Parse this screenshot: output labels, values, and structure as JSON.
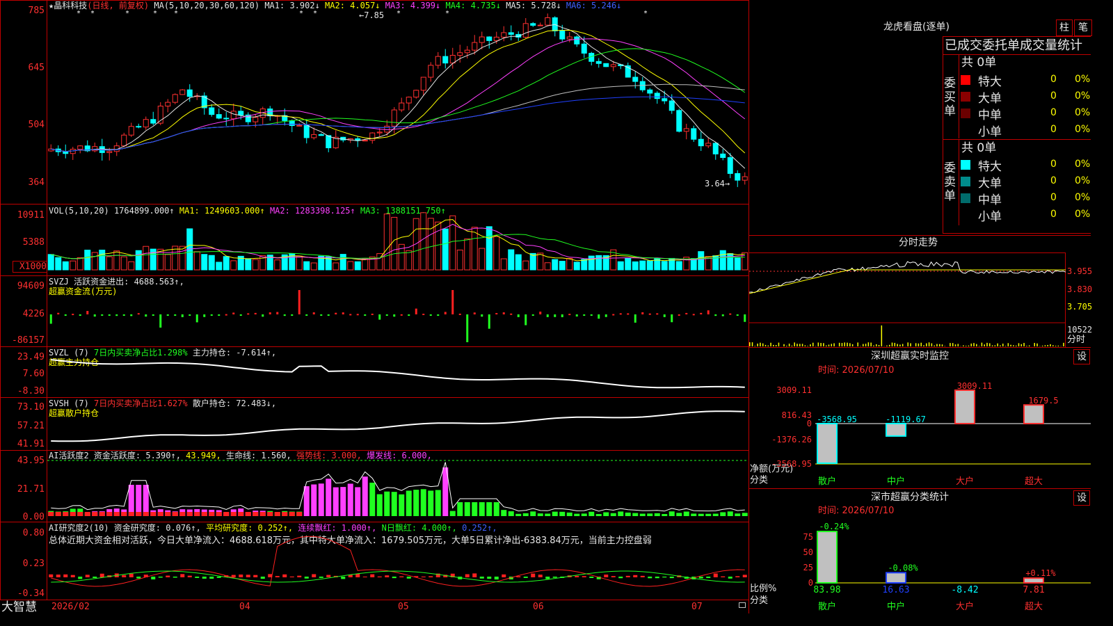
{
  "stock": {
    "title": "★晶科科技",
    "period": "(日线, 前复权)"
  },
  "ma_header": {
    "label": "MA(5,10,20,30,60,120)",
    "ma1": "MA1: 3.902↓",
    "ma2": "MA2: 4.057↓",
    "ma3": "MA3: 4.399↓",
    "ma4": "MA4: 4.735↓",
    "ma5": "MA5: 5.728↓",
    "ma6": "MA6: 5.246↓"
  },
  "price_axis": [
    "785",
    "645",
    "504",
    "364"
  ],
  "price_marks": {
    "high": "←7.85",
    "low": "3.64→"
  },
  "vol_header": {
    "label": "VOL(5,10,20)",
    "vol": "1764899.000↑",
    "ma1": "MA1: 1249603.000↑",
    "ma2": "MA2: 1283398.125↑",
    "ma3": "MA3: 1388151.750↑"
  },
  "vol_axis": [
    "10911",
    "5388",
    "X1000"
  ],
  "svzj": {
    "label": "SVZJ  活跃资金进出: 4688.563↑,",
    "sub": "超赢资金流(万元)",
    "axis": [
      "94609",
      "4226",
      "-86157"
    ]
  },
  "svzl": {
    "label": "SVZL (7)",
    "pct": "7日内买卖净占比1.298%",
    "hold": "主力持仓: -7.614↑,",
    "sub": "超赢主力持仓",
    "axis": [
      "23.49",
      "7.60",
      "-8.30"
    ]
  },
  "svsh": {
    "label": "SVSH (7)",
    "pct": "7日内买卖净占比1.627%",
    "hold": "散户持仓: 72.483↓,",
    "sub": "超赢散户持仓",
    "axis": [
      "73.10",
      "57.21",
      "41.91"
    ]
  },
  "ai_active": {
    "label": "AI活跃度2 资金活跃度: 5.390↑,",
    "v2": "43.949,",
    "life": "生命线: 1.560,",
    "strong": "强势线: 3.000,",
    "burst": "爆发线: 6.000,",
    "axis": [
      "43.95",
      "21.71",
      "0.00"
    ]
  },
  "ai_research": {
    "label": "AI研究度2(10) 资金研究度: 0.076↑,",
    "avg": "平均研究度: 0.252↑,",
    "cont": "连续飘红: 1.000↑,",
    "nday": "N日飘红: 4.000↑,",
    "last": "0.252↑,",
    "summary": "总体近期大资金相对活跃，今日大单净流入：4688.618万元，其中特大单净流入：1679.505万元，大单5日累计净出-6383.84万元，当前主力控盘弱",
    "axis": [
      "0.80",
      "0.23",
      "-0.34"
    ]
  },
  "time_axis": [
    "2026/02",
    "04",
    "05",
    "06",
    "07"
  ],
  "brand": "大智慧",
  "dragon": {
    "title": "龙虎看盘(逐单)",
    "btn1": "柱",
    "btn2": "笔",
    "subtitle": "已成交委托单成交量统计"
  },
  "buy": {
    "side": "委买单",
    "total": "共 0单",
    "rows": [
      {
        "name": "特大",
        "n": "0",
        "p": "0%"
      },
      {
        "name": "大单",
        "n": "0",
        "p": "0%"
      },
      {
        "name": "中单",
        "n": "0",
        "p": "0%"
      },
      {
        "name": "小单",
        "n": "0",
        "p": "0%"
      }
    ]
  },
  "sell": {
    "side": "委卖单",
    "total": "共 0单",
    "rows": [
      {
        "name": "特大",
        "n": "0",
        "p": "0%"
      },
      {
        "name": "大单",
        "n": "0",
        "p": "0%"
      },
      {
        "name": "中单",
        "n": "0",
        "p": "0%"
      },
      {
        "name": "小单",
        "n": "0",
        "p": "0%"
      }
    ]
  },
  "colors": {
    "buy": [
      "#ff0000",
      "#8b0000",
      "#6b0000"
    ],
    "sell": [
      "#00ffff",
      "#008b8b",
      "#006b6b"
    ]
  },
  "intraday": {
    "title": "分时走势",
    "axis": [
      "3.955",
      "3.830",
      "3.705"
    ],
    "vol": "10522",
    "vol2": "分时"
  },
  "monitor": {
    "title": "深圳超赢实时监控",
    "btn": "设",
    "time": "时间: 2026/07/10",
    "axis": [
      "3009.11",
      "816.43",
      "0",
      "-1376.26",
      "-3568.95"
    ],
    "ylabel": "净额(万元)",
    "xlabel": "分类",
    "chart_data": {
      "type": "bar",
      "categories": [
        "散户",
        "中户",
        "大户",
        "超大"
      ],
      "values": [
        -3568.95,
        -1119.67,
        3009.11,
        1679.5
      ],
      "labels": [
        "-3568.95",
        "-1119.67",
        "3009.11",
        "1679.5"
      ]
    }
  },
  "classify": {
    "title": "深市超赢分类统计",
    "btn": "设",
    "time": "时间: 2026/07/10",
    "axis": [
      "75",
      "50",
      "25",
      "0"
    ],
    "ylabel": "比例%",
    "xlabel": "分类",
    "chart_data": {
      "type": "bar",
      "categories": [
        "散户",
        "中户",
        "大户",
        "超大"
      ],
      "values": [
        83.98,
        16.63,
        -8.42,
        7.81
      ],
      "changes": [
        "-0.24%",
        "-0.08%",
        "",
        "+0.11%"
      ]
    },
    "values_text": [
      "83.98",
      "16.63",
      "-8.42",
      "7.81"
    ]
  }
}
